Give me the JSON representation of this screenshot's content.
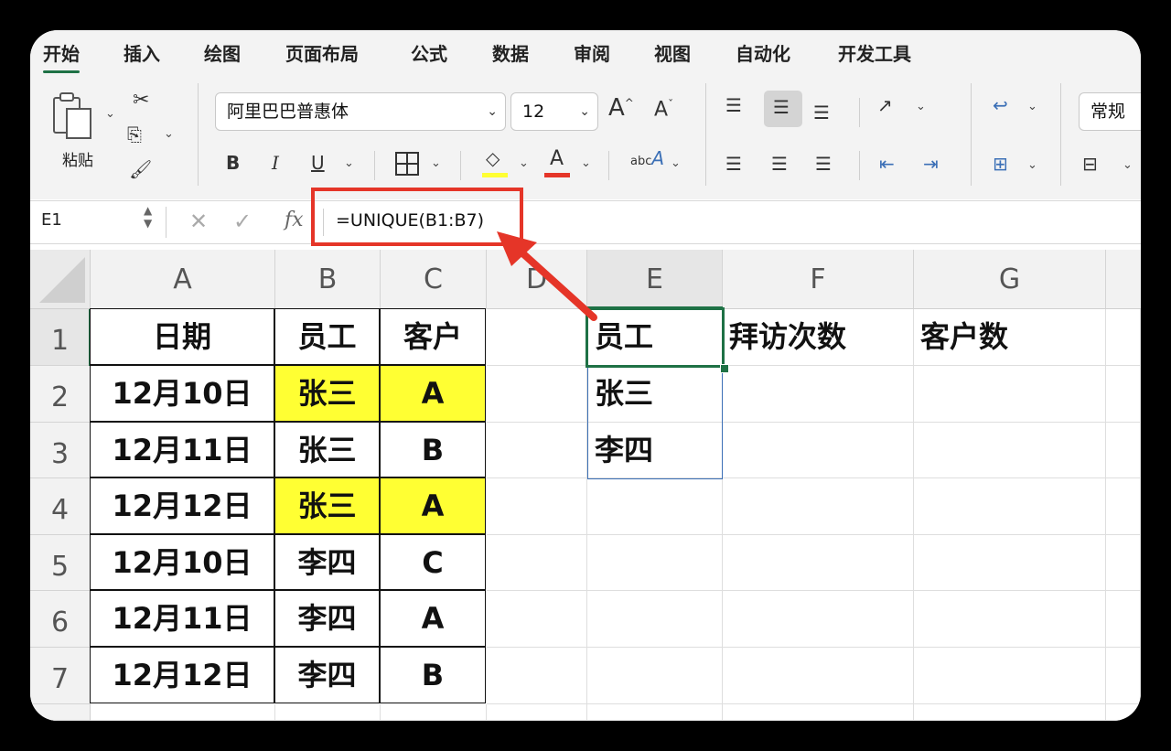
{
  "tabs": [
    "开始",
    "插入",
    "绘图",
    "页面布局",
    "公式",
    "数据",
    "审阅",
    "视图",
    "自动化",
    "开发工具"
  ],
  "ribbon": {
    "paste_label": "粘贴",
    "font_name": "阿里巴巴普惠体",
    "font_size": "12",
    "bold": "B",
    "italic": "I",
    "underline": "U",
    "number_format": "常规",
    "font_grow": "A",
    "font_shrink": "A",
    "font_color_letter": "A",
    "abc_label": "abc"
  },
  "formula_bar": {
    "name_box": "E1",
    "fx": "fx",
    "formula": "=UNIQUE(B1:B7)"
  },
  "columns": [
    "A",
    "B",
    "C",
    "D",
    "E",
    "F",
    "G"
  ],
  "rows": [
    "1",
    "2",
    "3",
    "4",
    "5",
    "6",
    "7"
  ],
  "table": {
    "headers": [
      "日期",
      "员工",
      "客户"
    ],
    "rows": [
      [
        "12月10日",
        "张三",
        "A"
      ],
      [
        "12月11日",
        "张三",
        "B"
      ],
      [
        "12月12日",
        "张三",
        "A"
      ],
      [
        "12月10日",
        "李四",
        "C"
      ],
      [
        "12月11日",
        "李四",
        "A"
      ],
      [
        "12月12日",
        "李四",
        "B"
      ]
    ]
  },
  "summary": {
    "headers": [
      "员工",
      "拜访次数",
      "客户数"
    ],
    "values": [
      "张三",
      "李四"
    ]
  },
  "colors": {
    "highlight": "#ffff33",
    "annotation": "#e53528",
    "accent": "#1e7145",
    "spill_border": "#3b6fb6"
  }
}
